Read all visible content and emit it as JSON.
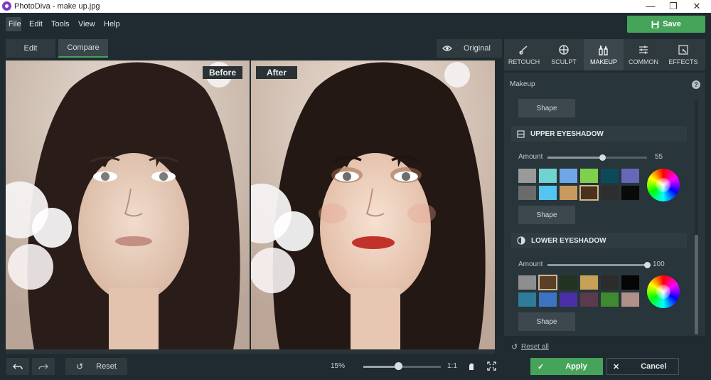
{
  "window": {
    "title": "PhotoDiva - make up.jpg",
    "minimize": "—",
    "restore": "❐",
    "close": "✕"
  },
  "menu": [
    "File",
    "Edit",
    "Tools",
    "View",
    "Help"
  ],
  "toolbar": {
    "save_label": "Save"
  },
  "view_tabs": {
    "edit": "Edit",
    "compare": "Compare",
    "original": "Original"
  },
  "canvas": {
    "before_label": "Before",
    "after_label": "After"
  },
  "tools": [
    {
      "label": "RETOUCH",
      "icon": "retouch-brush-icon"
    },
    {
      "label": "SCULPT",
      "icon": "sculpt-crosshair-icon"
    },
    {
      "label": "MAKEUP",
      "icon": "makeup-icon",
      "active": true
    },
    {
      "label": "COMMON",
      "icon": "sliders-icon"
    },
    {
      "label": "EFFECTS",
      "icon": "effects-icon"
    }
  ],
  "panel": {
    "title": "Makeup",
    "shape_label": "Shape",
    "upper": {
      "title": "UPPER EYESHADOW",
      "amount_label": "Amount",
      "amount": 55,
      "swatches": [
        "#9a9a9a",
        "#6fd3cf",
        "#6fa7e6",
        "#7fd14d",
        "#0d4a59",
        "#6667b8",
        "#6b6b6b",
        "#54c5f0",
        "#c99a5e",
        "#4b321c",
        "#2e2e2e",
        "#0a0a0a"
      ],
      "selected_index": 9
    },
    "lower": {
      "title": "LOWER EYESHADOW",
      "amount_label": "Amount",
      "amount": 100,
      "swatches": [
        "#8e8e8e",
        "#5a4028",
        "#233321",
        "#c6a156",
        "#2c2c2c",
        "#050505",
        "#2f7c9a",
        "#3c73c2",
        "#4b2fa7",
        "#5a3a4c",
        "#3f8a2f",
        "#b09088"
      ],
      "selected_index": 1
    },
    "reset_all": "Reset all"
  },
  "bottom": {
    "reset_label": "Reset",
    "zoom_label": "15%",
    "zoom_value": 0.45,
    "one_to_one": "1:1",
    "apply_label": "Apply",
    "cancel_label": "Cancel"
  },
  "colors": {
    "accent_green": "#45a35a",
    "background": "#1f2b30",
    "panel": "#28353a"
  }
}
